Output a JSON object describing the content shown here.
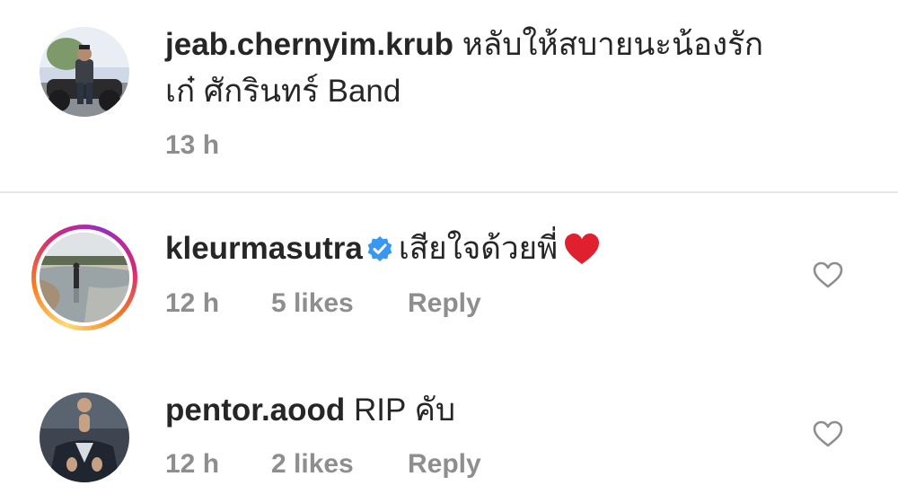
{
  "comments": [
    {
      "username": "jeab.chernyim.krub",
      "text_line1": "หลับให้สบายนะน้องรัก",
      "text_line2": "เก๋ ศักรินทร์ Band",
      "time": "13 h",
      "likes": "",
      "reply": ""
    },
    {
      "username": "kleurmasutra",
      "verified": true,
      "text_line1": "เสียใจด้วยพี่",
      "time": "12 h",
      "likes": "5 likes",
      "reply": "Reply",
      "has_story_ring": true
    },
    {
      "username": "pentor.aood",
      "text_line1": "RIP คับ",
      "time": "12 h",
      "likes": "2 likes",
      "reply": "Reply"
    }
  ],
  "icons": {
    "like": "heart-outline-icon",
    "verified": "verified-badge-icon",
    "emoji": "red-heart-emoji"
  },
  "colors": {
    "text": "#262626",
    "meta": "#8e8e8e",
    "verified": "#3897f0",
    "emoji_heart": "#e0202e",
    "divider": "#e6e6e6"
  }
}
